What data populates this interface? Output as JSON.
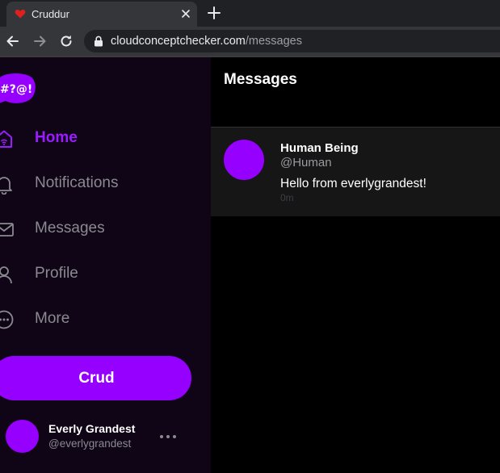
{
  "browser": {
    "tab_title": "Cruddur",
    "url_domain": "cloudconceptchecker.com",
    "url_path": "/messages"
  },
  "sidebar": {
    "logo_text": "#?@!",
    "nav": [
      {
        "label": "Home",
        "icon": "home-icon",
        "active": true
      },
      {
        "label": "Notifications",
        "icon": "bell-icon",
        "active": false
      },
      {
        "label": "Messages",
        "icon": "mail-icon",
        "active": false
      },
      {
        "label": "Profile",
        "icon": "person-icon",
        "active": false
      },
      {
        "label": "More",
        "icon": "more-circle-icon",
        "active": false
      }
    ],
    "crud_label": "Crud",
    "user": {
      "name": "Everly Grandest",
      "handle": "@everlygrandest"
    }
  },
  "main": {
    "title": "Messages",
    "messages": [
      {
        "name": "Human Being",
        "handle": "@Human",
        "text": "Hello from everlygrandest!",
        "time": "0m"
      }
    ]
  },
  "colors": {
    "accent": "#9600ff",
    "active_nav": "#9b1cff",
    "sidebar_bg": "#100417",
    "main_bg": "#000000",
    "message_bg": "#161616"
  }
}
